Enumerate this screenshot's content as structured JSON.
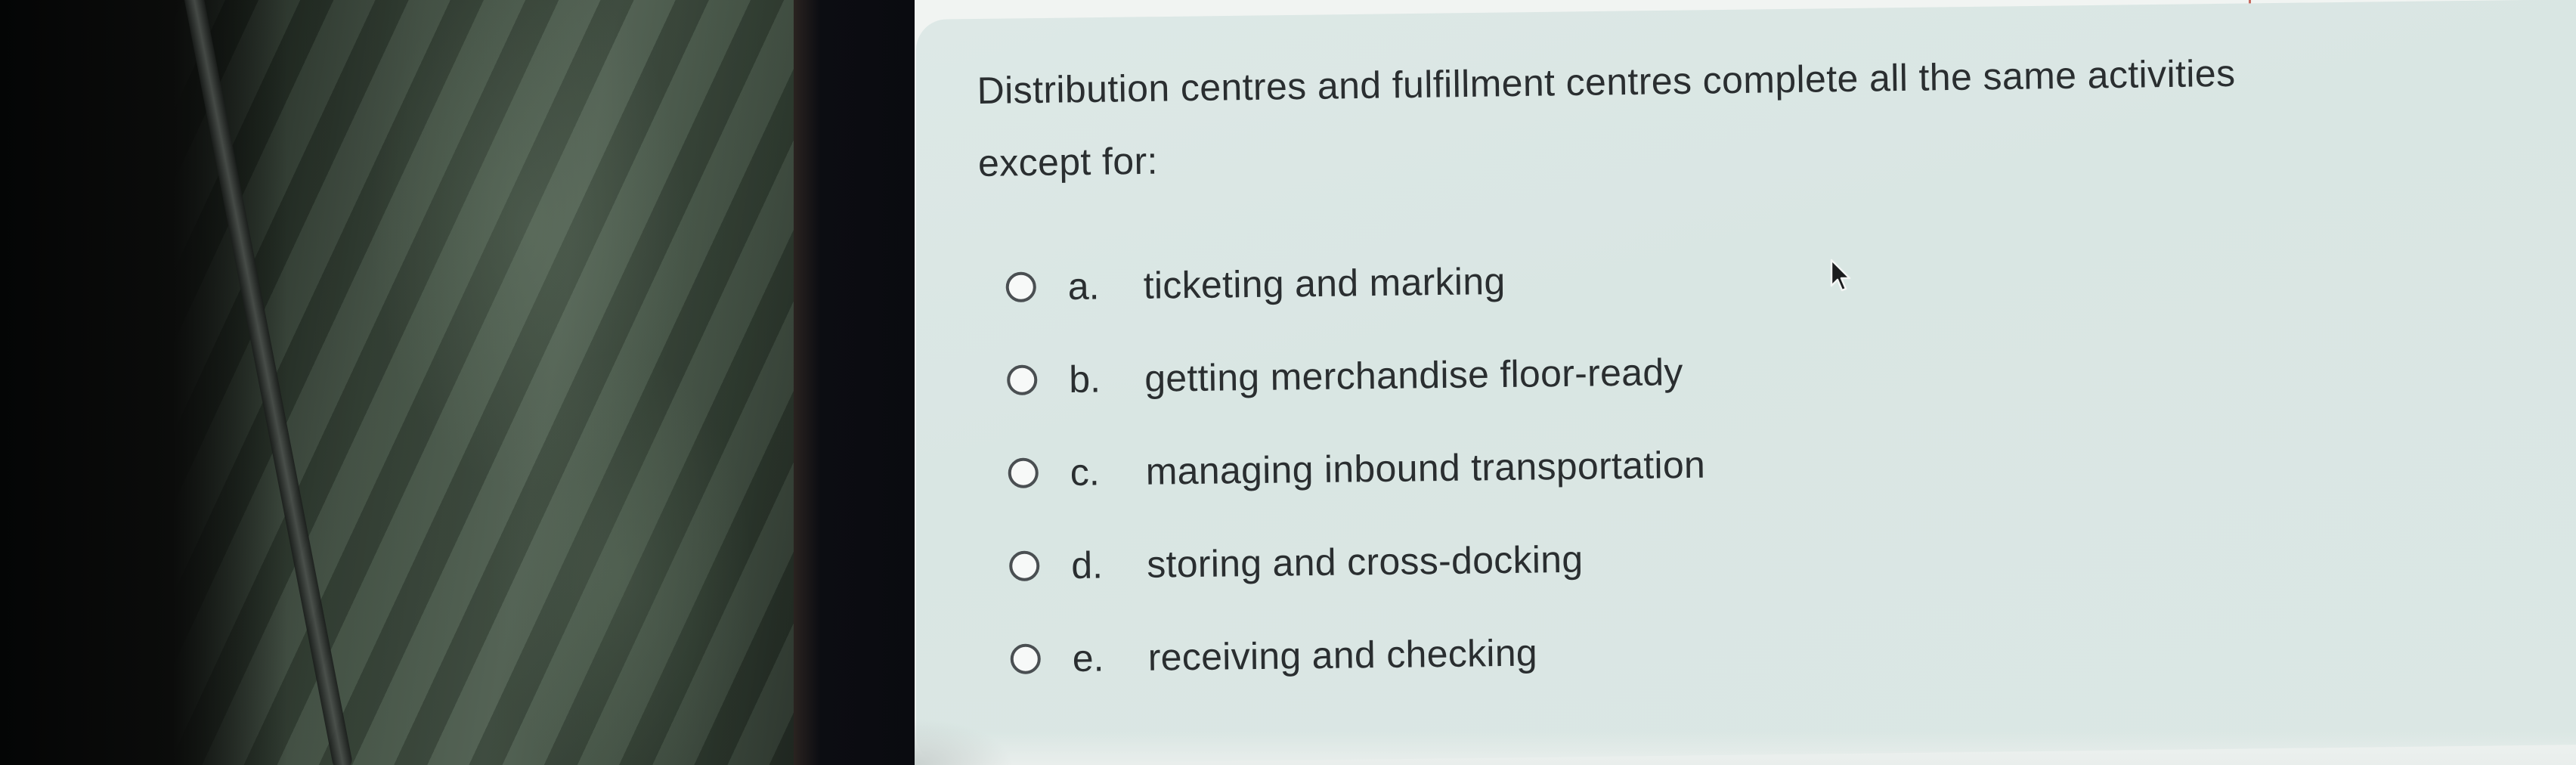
{
  "question": {
    "line1": "Distribution centres and fulfillment centres complete all the same activities",
    "line2": "except for:"
  },
  "options": [
    {
      "letter": "a.",
      "text": "ticketing and marking",
      "selected": false
    },
    {
      "letter": "b.",
      "text": "getting merchandise floor-ready",
      "selected": false
    },
    {
      "letter": "c.",
      "text": "managing inbound transportation",
      "selected": false
    },
    {
      "letter": "d.",
      "text": "storing and cross-docking",
      "selected": false
    },
    {
      "letter": "e.",
      "text": "receiving and checking",
      "selected": false
    }
  ],
  "colors": {
    "card_background": "#dbe7e4",
    "text": "#2a2e30",
    "radio_border": "#4a4f52",
    "frame_accent": "#c66a5e"
  },
  "icons": {
    "cursor": "mouse-pointer-icon",
    "radio": "radio-unchecked-icon"
  }
}
